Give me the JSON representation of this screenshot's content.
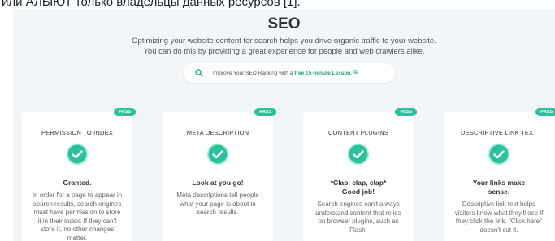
{
  "page": {
    "top_caption": "или АЛЫЮТ только владельцы данных ресурсов [1]."
  },
  "seo": {
    "title": "SEO",
    "description_line1": "Optimizing your website content for search helps you drive organic traffic to your website.",
    "description_line2": "You can do this by providing a great experience for people and web crawlers alike.",
    "lesson_prefix": "Improve Your SEO Ranking with a",
    "lesson_link": "free 15-minute Lesson.",
    "accent_color": "#2cc09c"
  },
  "cards": [
    {
      "badge": "PASS",
      "title": "PERMISSION TO INDEX",
      "headline": "Granted.",
      "body": "In order for a page to appear in search results, search engines must have permission to store it in their index. If they can't store it, no other changes matter."
    },
    {
      "badge": "PASS",
      "title": "META DESCRIPTION",
      "headline": "Look at you go!",
      "body": "Meta descriptions tell people what your page is about in search results."
    },
    {
      "badge": "PASS",
      "title": "CONTENT PLUGINS",
      "headline": "*Clap, clap, clap* Good job!",
      "body": "Search engines can't always understand content that relies on browser plugins, such as Flash."
    },
    {
      "badge": "PASS",
      "title": "DESCRIPTIVE LINK TEXT",
      "headline": "Your links make sense.",
      "body": "Descriptive link text helps visitors know what they'll see if they click the link. \"Click here\" doesn't cut it."
    }
  ]
}
